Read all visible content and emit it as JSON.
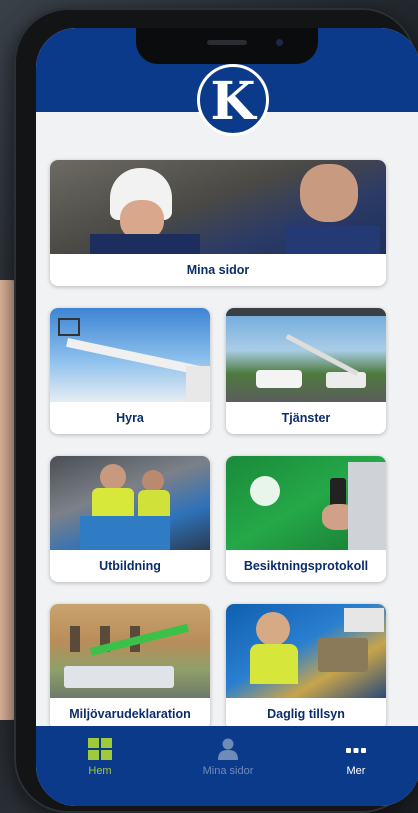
{
  "brand": {
    "logo_letter": "K",
    "primary_color": "#0b3a8a",
    "accent_color": "#9fca3a"
  },
  "tiles": {
    "mina_sidor": "Mina sidor",
    "hyra": "Hyra",
    "tjanster": "Tjänster",
    "utbildning": "Utbildning",
    "besiktningsprotokoll": "Besiktningsprotokoll",
    "miljovarudeklaration": "Miljövarudeklaration",
    "daglig_tillsyn": "Daglig tillsyn"
  },
  "tabbar": {
    "items": [
      {
        "label": "Hem",
        "icon": "grid-icon",
        "active": true
      },
      {
        "label": "Mina sidor",
        "icon": "person-icon",
        "active": false
      },
      {
        "label": "Mer",
        "icon": "more-dots-icon",
        "active": false
      }
    ]
  }
}
